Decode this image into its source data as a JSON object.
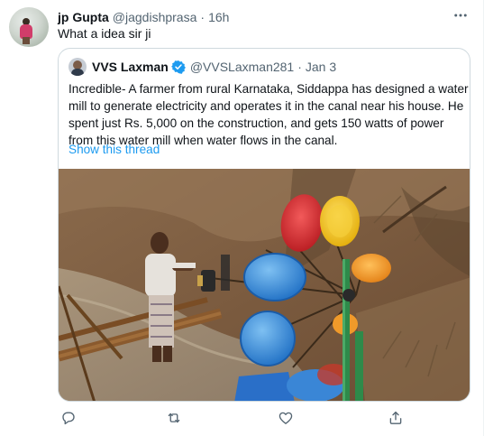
{
  "tweet": {
    "display_name": "jp Gupta",
    "handle": "@jagdishprasa",
    "separator": "·",
    "time": "16h",
    "text": "What a idea sir ji"
  },
  "quote": {
    "display_name": "VVS Laxman",
    "handle": "@VVSLaxman281",
    "separator": "·",
    "time": "Jan 3",
    "text_lines": [
      "Incredible- A farmer from rural Karnataka, Siddappa has designed a water",
      "mill to generate electricity and operates it in the canal near his house. He",
      "spent just Rs. 5,000 on the construction, and gets 150 watts of power",
      "from this water mill when water flows in the canal."
    ],
    "show_thread": "Show this thread"
  },
  "colors": {
    "link": "#1d9bf0",
    "secondary_text": "#536471",
    "border": "#cfd9de"
  },
  "icons": {
    "more": "more-horizontal-icon",
    "reply": "reply-icon",
    "retweet": "retweet-icon",
    "like": "heart-icon",
    "share": "share-icon",
    "verified": "verified-badge-icon"
  }
}
